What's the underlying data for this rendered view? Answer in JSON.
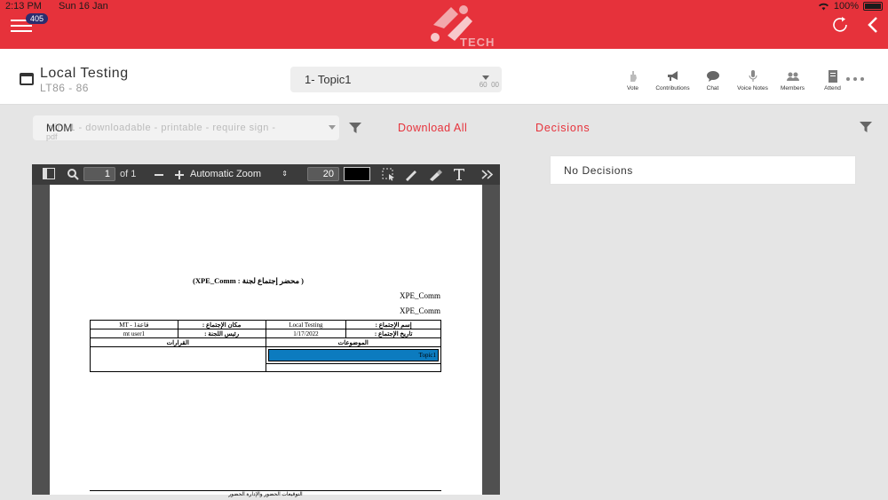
{
  "status_bar": {
    "time": "2:13 PM",
    "date": "Sun 16 Jan",
    "battery": "100%"
  },
  "app": {
    "logo_text": "TECH",
    "notification_count": "405"
  },
  "meeting": {
    "title": "Local Testing",
    "subtitle": "LT86 - 86"
  },
  "topic_select": {
    "selected": "1- Topic1",
    "count_left": "60",
    "count_right": "00"
  },
  "toolbar": {
    "items": [
      {
        "label": "Vote",
        "icon": "vote-hand-icon"
      },
      {
        "label": "Contributions",
        "icon": "megaphone-icon"
      },
      {
        "label": "Chat",
        "icon": "chat-icon"
      },
      {
        "label": "Voice Notes",
        "icon": "microphone-icon"
      },
      {
        "label": "Members",
        "icon": "members-icon"
      },
      {
        "label": "Attend",
        "icon": "attend-icon"
      }
    ]
  },
  "mom_select": {
    "label": "MOM",
    "placeholder": "min. 1 - downloadable - printable - require sign -",
    "placeholder_2": "pdf"
  },
  "actions": {
    "download_all": "Download All",
    "decisions_tab": "Decisions"
  },
  "pdf_viewer": {
    "page_number": "1",
    "page_total": "of 1",
    "zoom": "Automatic Zoom",
    "font_size": "20"
  },
  "document": {
    "title": "( محضر إجتماع لجنة : XPE_Comm)",
    "line1": "XPE_Comm",
    "line2": "XPE_Comm",
    "row1": {
      "label_a": "إسم الإجتماع :",
      "value_a": "Local Testing",
      "label_b": "مكان الإجتماع :",
      "value_b": "MT - قاعة1"
    },
    "row2": {
      "label_a": "تاريخ الإجتماع :",
      "value_a": "1/17/2022",
      "label_b": "رئيس اللجنة :",
      "value_b": "mt user1"
    },
    "row3": {
      "topics_header": "الموضوعات",
      "decisions_header": "القرارات"
    },
    "topic_cell": "Topic1",
    "footer": "التوقيعات الحضور والإدارة الحضور"
  },
  "decisions_panel": {
    "empty_text": "No Decisions"
  }
}
